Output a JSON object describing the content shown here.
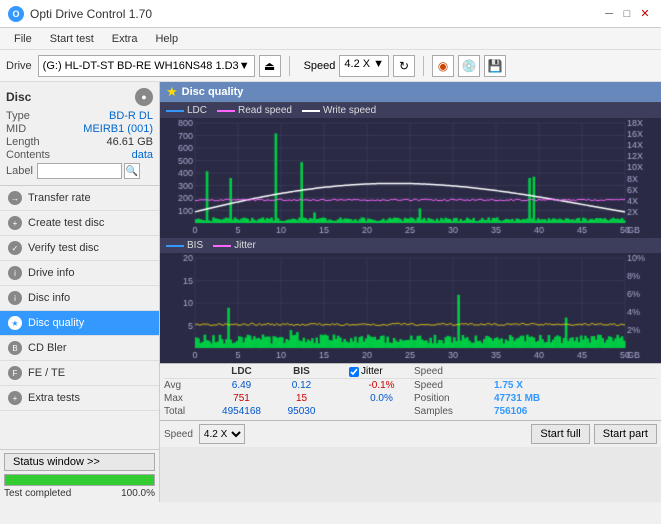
{
  "titleBar": {
    "icon": "O",
    "title": "Opti Drive Control 1.70",
    "minimize": "─",
    "maximize": "□",
    "close": "✕"
  },
  "menuBar": {
    "items": [
      "File",
      "Start test",
      "Extra",
      "Help"
    ]
  },
  "toolbar": {
    "driveLabel": "Drive",
    "driveText": "(G:)  HL-DT-ST BD-RE  WH16NS48 1.D3",
    "speedLabel": "Speed",
    "speedValue": "4.2 X"
  },
  "sidebar": {
    "discTitle": "Disc",
    "discInfo": {
      "type": {
        "key": "Type",
        "val": "BD-R DL"
      },
      "mid": {
        "key": "MID",
        "val": "MEIRB1 (001)"
      },
      "length": {
        "key": "Length",
        "val": "46.61 GB"
      },
      "contents": {
        "key": "Contents",
        "val": "data"
      },
      "label": {
        "key": "Label",
        "val": ""
      }
    },
    "navItems": [
      {
        "id": "transfer-rate",
        "label": "Transfer rate",
        "active": false
      },
      {
        "id": "create-test-disc",
        "label": "Create test disc",
        "active": false
      },
      {
        "id": "verify-test-disc",
        "label": "Verify test disc",
        "active": false
      },
      {
        "id": "drive-info",
        "label": "Drive info",
        "active": false
      },
      {
        "id": "disc-info",
        "label": "Disc info",
        "active": false
      },
      {
        "id": "disc-quality",
        "label": "Disc quality",
        "active": true
      },
      {
        "id": "cd-bler",
        "label": "CD Bler",
        "active": false
      },
      {
        "id": "fe-te",
        "label": "FE / TE",
        "active": false
      },
      {
        "id": "extra-tests",
        "label": "Extra tests",
        "active": false
      }
    ],
    "statusBtn": "Status window >>",
    "progressValue": 100,
    "statusText": "Test completed"
  },
  "qualityPanel": {
    "title": "Disc quality",
    "legend": {
      "ldc": "LDC",
      "readSpeed": "Read speed",
      "writeSpeed": "Write speed",
      "bis": "BIS",
      "jitter": "Jitter"
    },
    "topChart": {
      "yMax": 800,
      "yMin": 0,
      "rightYMax": 18,
      "rightYMin": 0,
      "xMax": 50,
      "xLabel": "GB"
    },
    "bottomChart": {
      "yMax": 20,
      "yMin": 0,
      "rightYMax": 10,
      "xMax": 50
    },
    "stats": {
      "headers": [
        "",
        "LDC",
        "BIS",
        "",
        "Jitter",
        "Speed",
        ""
      ],
      "avg": {
        "label": "Avg",
        "ldc": "6.49",
        "bis": "0.12",
        "jitter": "-0.1%",
        "speedKey": "Speed",
        "speedVal": "1.75 X"
      },
      "max": {
        "label": "Max",
        "ldc": "751",
        "bis": "15",
        "jitter": "0.0%",
        "posKey": "Position",
        "posVal": "47731 MB"
      },
      "total": {
        "label": "Total",
        "ldc": "4954168",
        "bis": "95030",
        "samplesKey": "Samples",
        "samplesVal": "756106"
      }
    },
    "speedDropdown": "4.2 X",
    "startFullBtn": "Start full",
    "startPartBtn": "Start part",
    "jitterChecked": true
  }
}
